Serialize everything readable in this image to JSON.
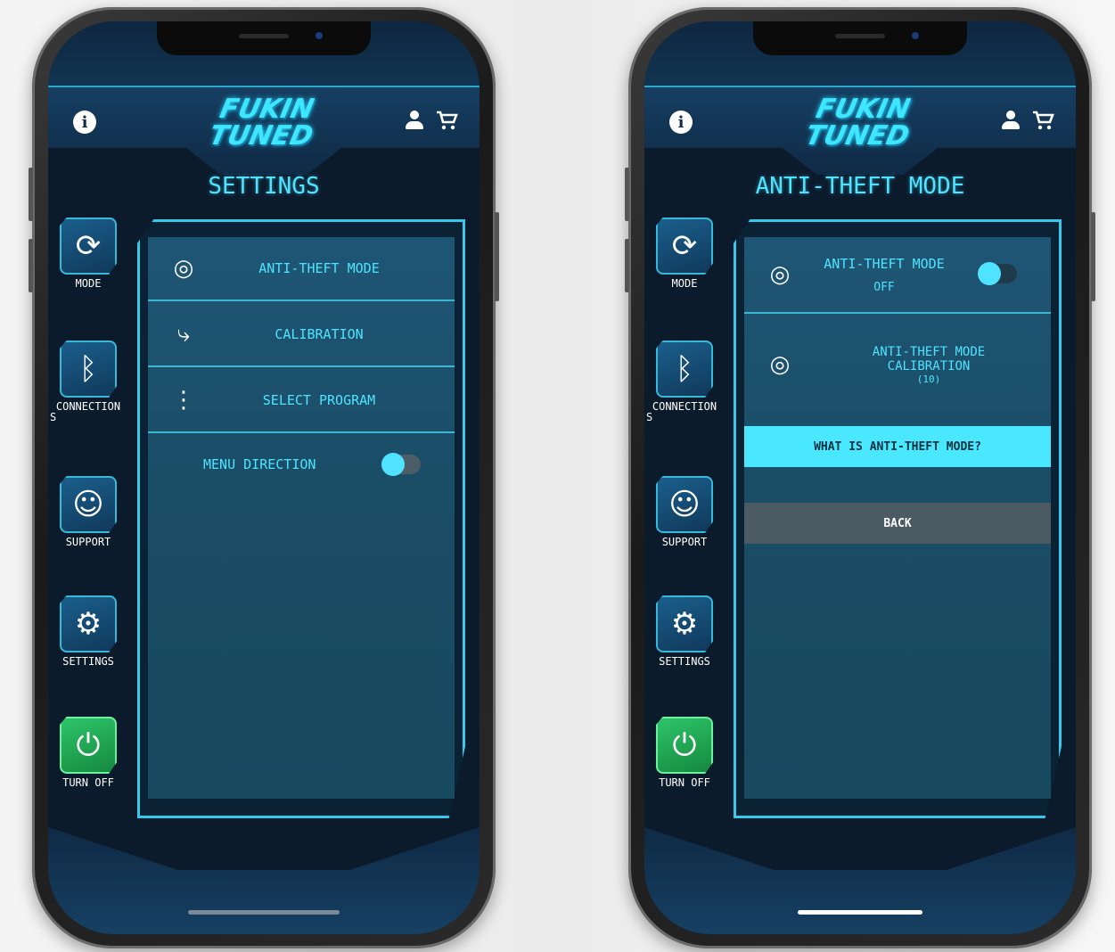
{
  "brand": {
    "logo_line1": "FUKIN",
    "logo_line2": "TUNED"
  },
  "header": {
    "info_icon": "info-icon",
    "user_icon": "user-icon",
    "cart_icon": "cart-icon",
    "info_glyph": "i"
  },
  "rail": [
    {
      "id": "mode",
      "label": "MODE",
      "icon": "sync-icon",
      "glyph": "⟳"
    },
    {
      "id": "connections",
      "label_line1": "CONNECTION",
      "label_line2": "S",
      "icon": "bluetooth-icon",
      "glyph": "ᛒ"
    },
    {
      "id": "support",
      "label": "SUPPORT",
      "icon": "headset-icon",
      "glyph": "☺"
    },
    {
      "id": "settings",
      "label": "SETTINGS",
      "icon": "gear-icon",
      "glyph": "⚙"
    },
    {
      "id": "turn_off",
      "label": "TURN OFF",
      "icon": "power-icon",
      "glyph": "⏻"
    }
  ],
  "screen_left": {
    "title": "SETTINGS",
    "menu": [
      {
        "label": "ANTI-THEFT MODE",
        "icon": "fingerprint-icon",
        "glyph": "◎"
      },
      {
        "label": "CALIBRATION",
        "icon": "seat-icon",
        "glyph": "⤷"
      },
      {
        "label": "SELECT PROGRAM",
        "icon": "more-vertical-icon",
        "glyph": "⋮"
      }
    ],
    "menu_direction": {
      "label": "MENU DIRECTION",
      "on": true
    }
  },
  "screen_right": {
    "title": "ANTI-THEFT MODE",
    "anti_theft": {
      "label": "ANTI-THEFT MODE",
      "status": "OFF",
      "on": false,
      "icon": "fingerprint-icon",
      "glyph": "◎"
    },
    "calibration": {
      "line1": "ANTI-THEFT MODE",
      "line2": "CALIBRATION",
      "line3": "(10)",
      "icon": "fingerprint-icon",
      "glyph": "◎"
    },
    "cta_label": "WHAT IS ANTI-THEFT MODE?",
    "back_label": "BACK"
  },
  "colors": {
    "accent": "#4fe3ff",
    "panel": "#1a4d66",
    "power": "#2ec46a",
    "back": "#4c5a64"
  }
}
